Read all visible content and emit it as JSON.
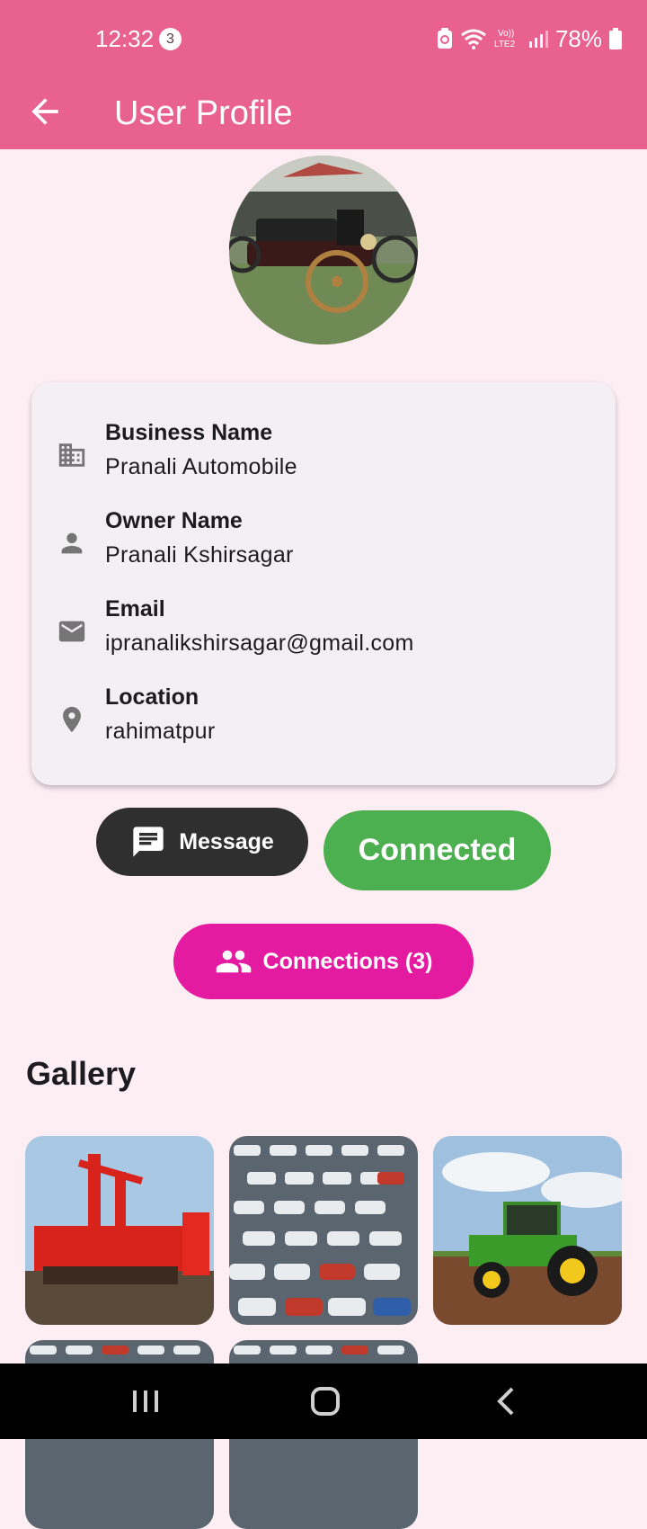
{
  "status_bar": {
    "time": "12:32",
    "notification_count": "3",
    "battery": "78%"
  },
  "app_bar": {
    "title": "User Profile",
    "back_icon": "arrow-left-icon"
  },
  "profile": {
    "fields": [
      {
        "icon": "business-icon",
        "label": "Business Name",
        "value": "Pranali Automobile"
      },
      {
        "icon": "person-icon",
        "label": "Owner Name",
        "value": "Pranali Kshirsagar"
      },
      {
        "icon": "email-icon",
        "label": "Email",
        "value": "ipranalikshirsagar@gmail.com"
      },
      {
        "icon": "location-pin-icon",
        "label": "Location",
        "value": "rahimatpur"
      }
    ]
  },
  "actions": {
    "message_label": "Message",
    "connected_label": "Connected",
    "connections_label": "Connections (3)"
  },
  "gallery": {
    "title": "Gallery"
  },
  "colors": {
    "app_bar": "#e8618f",
    "background": "#fdeef4",
    "card": "#f4eff5",
    "message_button": "#2f2f2f",
    "connected_button": "#4caf50",
    "connections_button": "#e41aa1"
  }
}
